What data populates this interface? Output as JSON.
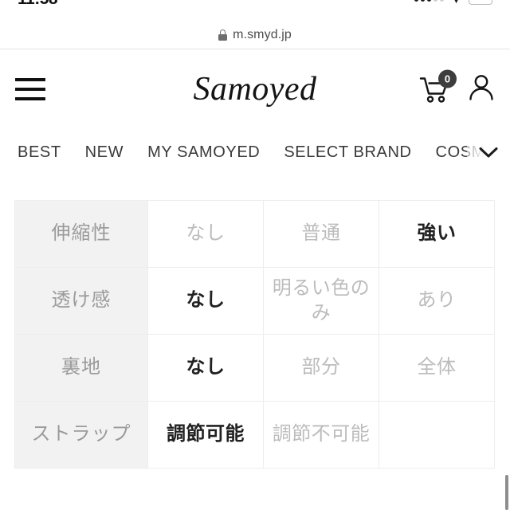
{
  "status_bar": {
    "clock": "11:58",
    "signal_label": "signal-strength",
    "wifi_label": "wifi",
    "battery_label": "battery"
  },
  "browser": {
    "url": "m.smyd.jp",
    "lock_label": "secure-connection"
  },
  "header": {
    "menu_label": "menu",
    "brand": "Samoyed",
    "cart_label": "cart",
    "cart_count": "0",
    "account_label": "account"
  },
  "category_nav": {
    "items": [
      {
        "label": "BEST"
      },
      {
        "label": "NEW"
      },
      {
        "label": "MY SAMOYED"
      },
      {
        "label": "SELECT BRAND"
      },
      {
        "label": "COSMETIC"
      }
    ],
    "expand_label": "expand-categories"
  },
  "spec_table": {
    "rows": [
      {
        "label": "伸縮性",
        "options": [
          {
            "text": "なし",
            "selected": false
          },
          {
            "text": "普通",
            "selected": false
          },
          {
            "text": "強い",
            "selected": true
          }
        ]
      },
      {
        "label": "透け感",
        "options": [
          {
            "text": "なし",
            "selected": true
          },
          {
            "text": "明るい色のみ",
            "selected": false
          },
          {
            "text": "あり",
            "selected": false
          }
        ]
      },
      {
        "label": "裏地",
        "options": [
          {
            "text": "なし",
            "selected": true
          },
          {
            "text": "部分",
            "selected": false
          },
          {
            "text": "全体",
            "selected": false
          }
        ]
      },
      {
        "label": "ストラップ",
        "options": [
          {
            "text": "調節可能",
            "selected": true
          },
          {
            "text": "調節不可能",
            "selected": false
          },
          {
            "text": "",
            "selected": false
          }
        ]
      }
    ]
  },
  "colors": {
    "header_cell_bg": "#f2f2f2",
    "header_cell_text": "#9b9b9b",
    "inactive_text": "#bcbcbc",
    "selected_text": "#212121",
    "border": "#ededed",
    "badge_bg": "#3d3d3d"
  }
}
